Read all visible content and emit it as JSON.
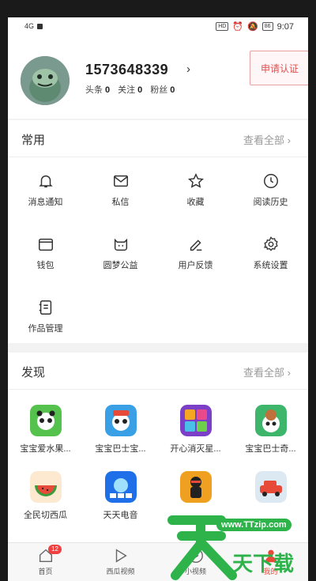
{
  "status_bar": {
    "signal": "4G",
    "hd": "HD",
    "battery": "86",
    "time": "9:07"
  },
  "profile": {
    "username": "1573648339",
    "stats": [
      {
        "label": "头条",
        "value": "0"
      },
      {
        "label": "关注",
        "value": "0"
      },
      {
        "label": "粉丝",
        "value": "0"
      }
    ],
    "apply_label": "申请认证"
  },
  "common": {
    "title": "常用",
    "more": "查看全部",
    "items": [
      {
        "label": "消息通知",
        "icon": "bell-icon"
      },
      {
        "label": "私信",
        "icon": "mail-icon"
      },
      {
        "label": "收藏",
        "icon": "star-icon"
      },
      {
        "label": "阅读历史",
        "icon": "clock-icon"
      },
      {
        "label": "钱包",
        "icon": "wallet-icon"
      },
      {
        "label": "圆梦公益",
        "icon": "charity-icon"
      },
      {
        "label": "用户反馈",
        "icon": "feedback-pen-icon"
      },
      {
        "label": "系统设置",
        "icon": "gear-icon"
      },
      {
        "label": "作品管理",
        "icon": "works-icon"
      }
    ]
  },
  "discover": {
    "title": "发现",
    "more": "查看全部",
    "apps": [
      {
        "label": "宝宝爱水果...",
        "color": "#4cb84c"
      },
      {
        "label": "宝宝巴士宝...",
        "color": "#3a9be0"
      },
      {
        "label": "开心消灭星...",
        "color": "#8a4fd0"
      },
      {
        "label": "宝宝巴士奇...",
        "color": "#3db56a"
      },
      {
        "label": "全民切西瓜",
        "color": "#e84a3a"
      },
      {
        "label": "天天电音",
        "color": "#1e6ee6"
      },
      {
        "label": "",
        "color": "#f0a020"
      },
      {
        "label": "",
        "color": "#e0e8f0"
      }
    ]
  },
  "tabbar": {
    "tabs": [
      {
        "label": "首页",
        "badge": "12"
      },
      {
        "label": "西瓜视频"
      },
      {
        "label": "小视频"
      },
      {
        "label": "我的"
      }
    ]
  },
  "watermark": {
    "url": "www.TTzip.com",
    "text": "天天下载"
  }
}
